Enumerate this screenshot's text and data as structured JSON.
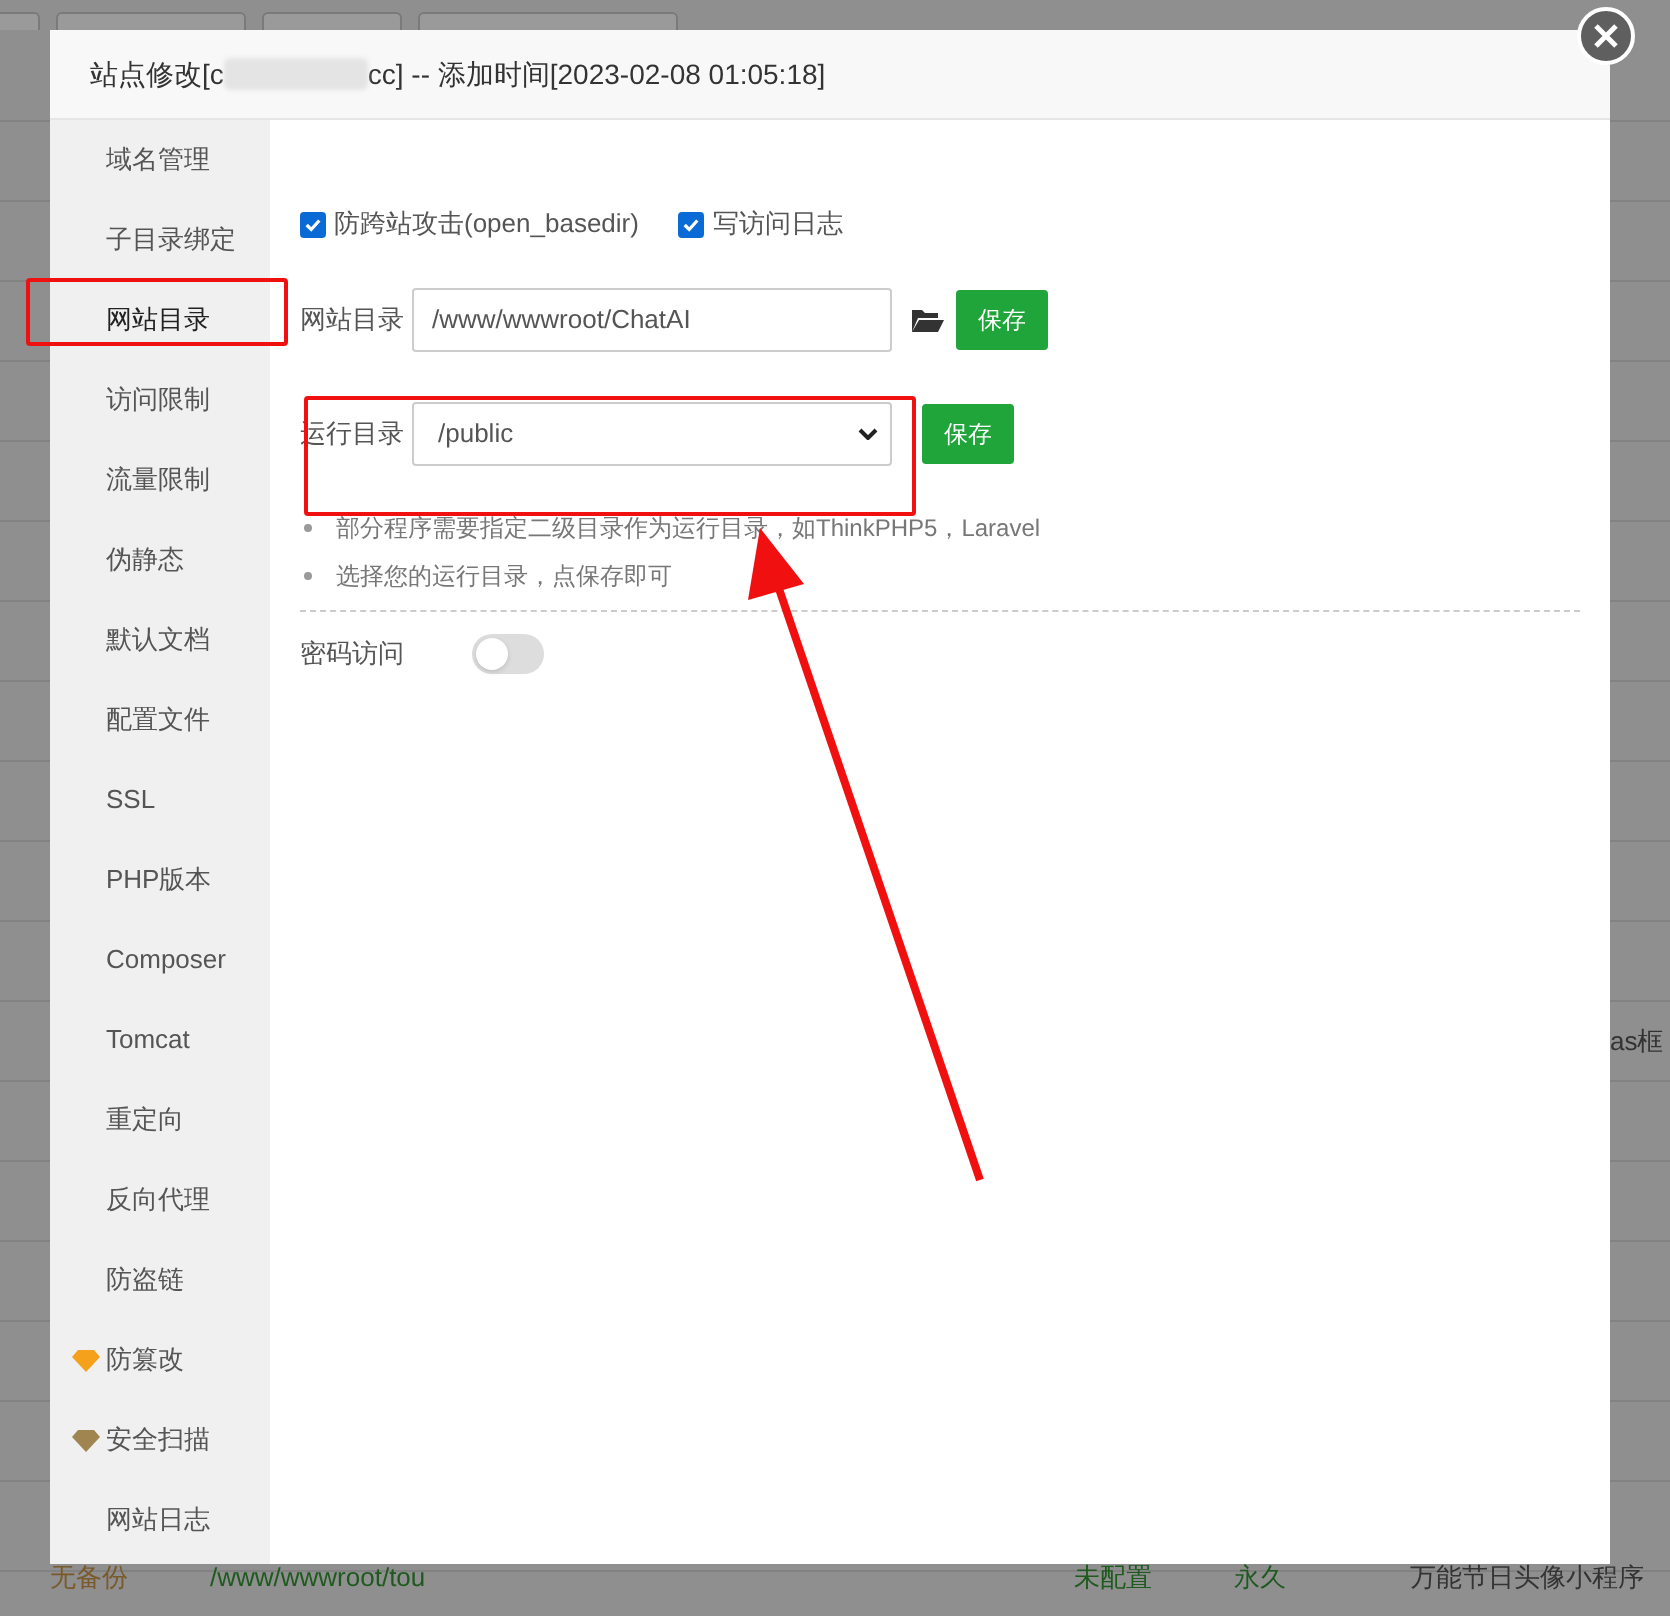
{
  "background": {
    "edge_text": "as框",
    "row": [
      "无备份",
      "/www/wwwroot/tou",
      "未配置",
      "永久",
      "万能节日头像小程序"
    ]
  },
  "dialog": {
    "title_start": "站点修改[c",
    "title_end": "cc] -- 添加时间[2023-02-08 01:05:18]"
  },
  "sidebar": {
    "items": [
      {
        "label": "域名管理",
        "selected": false
      },
      {
        "label": "子目录绑定",
        "selected": false
      },
      {
        "label": "网站目录",
        "selected": true
      },
      {
        "label": "访问限制",
        "selected": false
      },
      {
        "label": "流量限制",
        "selected": false
      },
      {
        "label": "伪静态",
        "selected": false
      },
      {
        "label": "默认文档",
        "selected": false
      },
      {
        "label": "配置文件",
        "selected": false
      },
      {
        "label": "SSL",
        "selected": false
      },
      {
        "label": "PHP版本",
        "selected": false
      },
      {
        "label": "Composer",
        "selected": false
      },
      {
        "label": "Tomcat",
        "selected": false
      },
      {
        "label": "重定向",
        "selected": false
      },
      {
        "label": "反向代理",
        "selected": false
      },
      {
        "label": "防盗链",
        "selected": false
      },
      {
        "label": "防篡改",
        "selected": false,
        "color": "#f5a11c"
      },
      {
        "label": "安全扫描",
        "selected": false,
        "color": "#a08550"
      },
      {
        "label": "网站日志",
        "selected": false
      }
    ]
  },
  "options": [
    {
      "label": "防跨站攻击(open_basedir)",
      "checked": true
    },
    {
      "label": "写访问日志",
      "checked": true
    }
  ],
  "site_dir": {
    "label": "网站目录",
    "value": "/www/wwwroot/ChatAI",
    "button": "保存"
  },
  "run_dir": {
    "label": "运行目录",
    "value": "/public",
    "button": "保存"
  },
  "notes": [
    "部分程序需要指定二级目录作为运行目录，如ThinkPHP5，Laravel",
    "选择您的运行目录，点保存即可"
  ],
  "password_access": {
    "label": "密码访问",
    "on": false
  }
}
